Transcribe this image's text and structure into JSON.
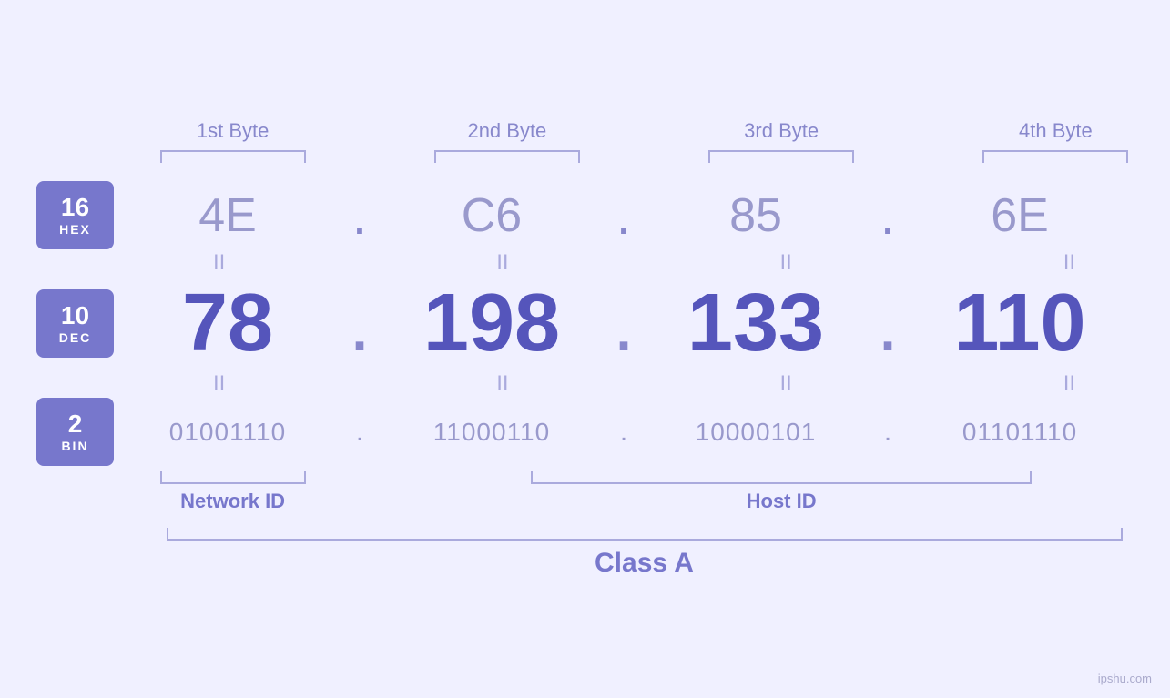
{
  "headers": {
    "byte1": "1st Byte",
    "byte2": "2nd Byte",
    "byte3": "3rd Byte",
    "byte4": "4th Byte"
  },
  "bases": {
    "hex": {
      "number": "16",
      "label": "HEX"
    },
    "dec": {
      "number": "10",
      "label": "DEC"
    },
    "bin": {
      "number": "2",
      "label": "BIN"
    }
  },
  "hex_row": {
    "b1": "4E",
    "b2": "C6",
    "b3": "85",
    "b4": "6E",
    "dot": "."
  },
  "dec_row": {
    "b1": "78",
    "b2": "198",
    "b3": "133",
    "b4": "110",
    "dot": "."
  },
  "bin_row": {
    "b1": "01001110",
    "b2": "11000110",
    "b3": "10000101",
    "b4": "01101110",
    "dot": "."
  },
  "equals": "II",
  "labels": {
    "network_id": "Network ID",
    "host_id": "Host ID",
    "class": "Class A"
  },
  "watermark": "ipshu.com"
}
